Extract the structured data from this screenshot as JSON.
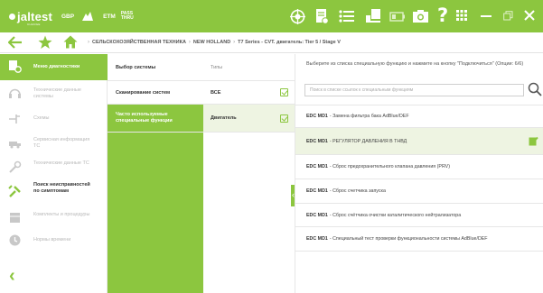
{
  "topbar": {
    "logo_text": "jaltest",
    "brand_tag": "CHANGE",
    "product1": "GBP",
    "product2_a": "ETM",
    "product2_b": "PASS",
    "product2_c": "THRU",
    "icons": [
      "target-icon",
      "document-icon",
      "list-icon",
      "truck-icon",
      "battery-icon",
      "camera-icon",
      "help-icon",
      "grid-icon",
      "minimize-icon",
      "restore-icon",
      "close-icon"
    ],
    "accent": "#8cc63f"
  },
  "breadcrumb": {
    "items": [
      "СЕЛЬСКОХОЗЯЙСТВЕННАЯ ТЕХНИКА",
      "NEW HOLLAND",
      "T7 Series - CVT. двигатель: Tier 5 / Stage V"
    ]
  },
  "sidebar": {
    "items": [
      {
        "label": "Меню диагностики",
        "icon": "diagnostic-menu-icon",
        "active": true
      },
      {
        "label": "Технические данные системы",
        "icon": "headset-icon"
      },
      {
        "label": "Схемы",
        "icon": "wiring-icon"
      },
      {
        "label": "Сервисная информация ТС",
        "icon": "service-truck-icon"
      },
      {
        "label": "Технические данные ТС",
        "icon": "wrench-icon"
      },
      {
        "label": "Поиск неисправностей по симптомам",
        "icon": "symptom-search-icon",
        "bold": true
      },
      {
        "label": "Комплекты и процедуры",
        "icon": "kit-icon"
      },
      {
        "label": "Нормы времени",
        "icon": "time-icon"
      }
    ],
    "back_label": "‹"
  },
  "col1": {
    "rows": [
      "Выбор системы",
      "Сканирование систем",
      "Часто используемые специальные функции"
    ]
  },
  "col2": {
    "header": "Типы",
    "rows": [
      "ВСЕ",
      "Двигатель"
    ]
  },
  "right": {
    "instruction": "Выберите из списка специальную функцию и нажмите на кнопку \"Подключиться\" (Опции: 6/6)",
    "search_placeholder": "Поиск в списке ссылок к специальным функциям",
    "functions": [
      {
        "code": "EDC MD1",
        "text": "- Замена фильтра бака AdBlue/DEF"
      },
      {
        "code": "EDC MD1",
        "text": "- РЕГУЛЯТОР ДАВЛЕНИЯ В ТНВД",
        "selected": true
      },
      {
        "code": "EDC MD1",
        "text": "- Сброс предохранительного клапана давления (PRV)"
      },
      {
        "code": "EDC MD1",
        "text": "- Сброс счетчика запуска"
      },
      {
        "code": "EDC MD1",
        "text": "- Сброс счётчика очистки каталитического нейтрализатора"
      },
      {
        "code": "EDC MD1",
        "text": "- Специальный тест проверки функциональности системы AdBlue/DEF"
      }
    ]
  }
}
